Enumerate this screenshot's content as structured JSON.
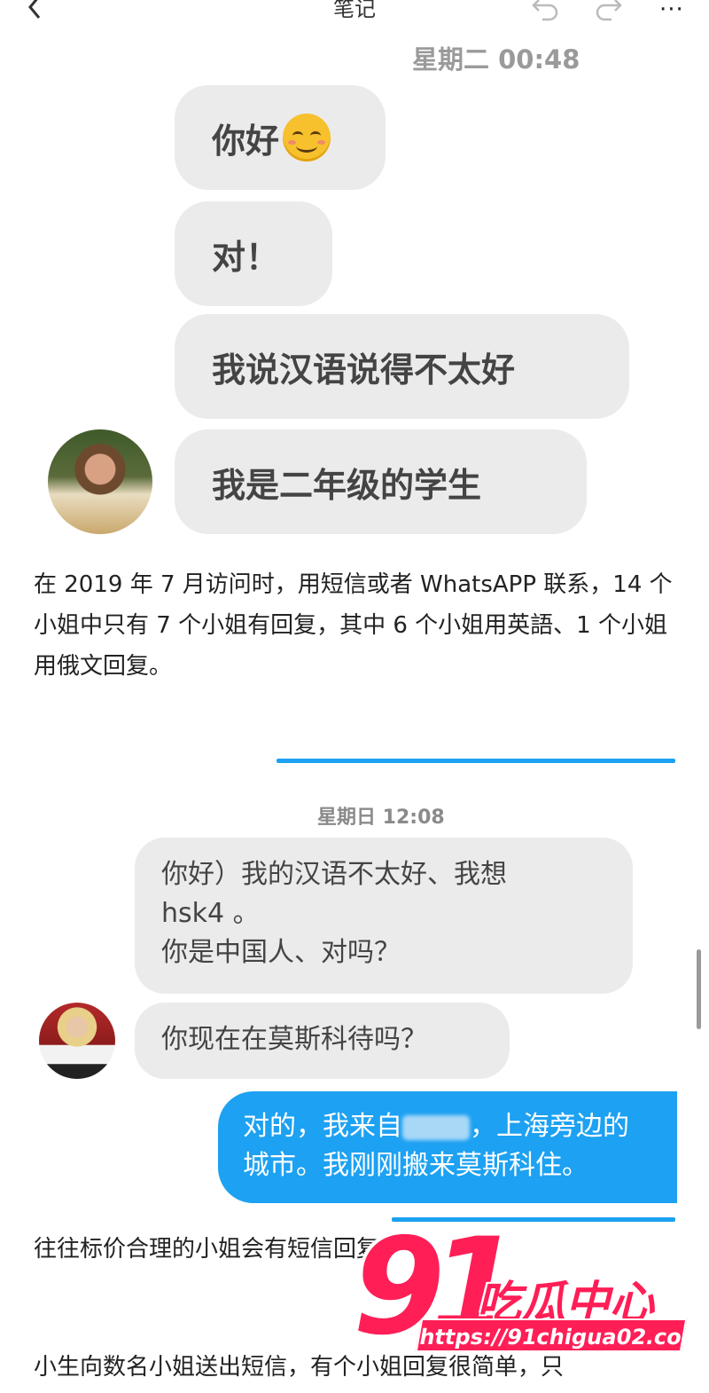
{
  "header": {
    "title": "笔记",
    "more": "···"
  },
  "chat1": {
    "timestamp": "星期二 00:48",
    "messages": [
      "你好",
      "对！",
      "我说汉语说得不太好",
      "我是二年级的学生"
    ]
  },
  "paragraph1": "在 2019 年 7 月访问时，用短信或者 WhatsAPP 联系，14 个小姐中只有 7 个小姐有回复，其中 6 个小姐用英語、1 个小姐用俄文回复。",
  "chat2": {
    "timestamp": "星期日 12:08",
    "msg1_line1": "你好）我的汉语不太好、我想",
    "msg1_line2": "hsk4 。",
    "msg1_line3": "你是中国人、对吗？",
    "msg2": "你现在在莫斯科待吗？",
    "reply_line1_a": "对的，我来自",
    "reply_line1_b": "，上海旁边的",
    "reply_line2": "城市。我刚刚搬来莫斯科住。"
  },
  "paragraph2": "往往标价合理的小姐会有短信回复",
  "paragraph3": "小生向数名小姐送出短信，有个小姐回复很简单，只",
  "watermark": {
    "number": "91",
    "brand": "吃瓜中心",
    "url": "https://91chigua02.com"
  },
  "colors": {
    "accent_blue": "#1da1f2",
    "watermark_red": "#ff1e56",
    "bubble_gray": "#ebebeb"
  }
}
